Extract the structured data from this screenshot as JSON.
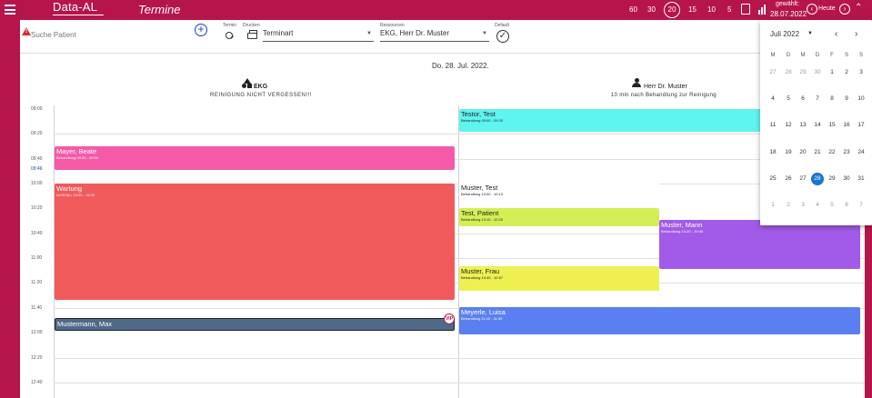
{
  "app": {
    "brand": "Data-AL",
    "title": "Termine",
    "zoom_levels": [
      "60",
      "30",
      "20",
      "15",
      "10",
      "5"
    ],
    "zoom_selected": "20",
    "selected_label": "gewählt:",
    "selected_date": "28.07.2022",
    "today_label": "Heute",
    "colors": {
      "primary": "#b5154b",
      "accent": "#1a3fb8"
    }
  },
  "toolbar": {
    "search_placeholder": "Suche Patient",
    "termin_label": "Termin",
    "drucken_label": "Drucken",
    "terminart_label": "Terminart",
    "ressourcen_label": "Ressourcen",
    "ressourcen_value": "EKG, Herr Dr. Muster",
    "default_label": "Default"
  },
  "calendar": {
    "date_heading": "Do. 28. Jul. 2022.",
    "resources": [
      {
        "name": "EKG",
        "note": "REINIGUNG NICHT VERGESSEN!!!"
      },
      {
        "name": "Herr Dr. Muster",
        "note": "10 min nach Behandlung zur Reinigung"
      }
    ],
    "time_labels": [
      "09:00",
      "09:20",
      "09:40",
      "09:46",
      "10:00",
      "10:20",
      "10:40",
      "11:00",
      "11:20",
      "11:40",
      "12:00",
      "12:20",
      "12:40"
    ],
    "appointments": [
      {
        "title": "Testor, Test",
        "sub": "Behandlung 09:00 - 09:20",
        "color": "#5ef4f0"
      },
      {
        "title": "Mayer, Beate",
        "sub": "Behandlung 09:30 - 09:50",
        "color": "#f45aa8"
      },
      {
        "title": "Wartung",
        "sub": "AUSFALL 10:00 - 11:00",
        "color": "#f05a5a"
      },
      {
        "title": "Muster, Test",
        "sub": "Behandlung 10:00 - 10:10",
        "color": "#ffffff"
      },
      {
        "title": "Test, Patient",
        "sub": "Behandlung 10:10 - 10:20",
        "color": "#d4ef55"
      },
      {
        "title": "Muster, Mann",
        "sub": "Behandlung 10:20 - 10:45",
        "color": "#a25ae8"
      },
      {
        "title": "Muster, Frau",
        "sub": "Behandlung 10:45 - 10:57",
        "color": "#eef052"
      },
      {
        "title": "Mustermann, Max",
        "sub": "",
        "color": "#4e6a8a",
        "badge": "VIP"
      },
      {
        "title": "Meyerle, Luisa",
        "sub": "Behandlung 11:10 - 11:30",
        "color": "#5a7ff0"
      }
    ]
  },
  "datepicker": {
    "month_label": "Juli 2022",
    "weekdays": [
      "M",
      "D",
      "M",
      "D",
      "F",
      "S",
      "S"
    ],
    "weeks": [
      [
        "27",
        "28",
        "29",
        "30",
        "1",
        "2",
        "3"
      ],
      [
        "4",
        "5",
        "6",
        "7",
        "8",
        "9",
        "10"
      ],
      [
        "11",
        "12",
        "13",
        "14",
        "15",
        "16",
        "17"
      ],
      [
        "18",
        "19",
        "20",
        "21",
        "22",
        "23",
        "24"
      ],
      [
        "25",
        "26",
        "27",
        "28",
        "29",
        "30",
        "31"
      ],
      [
        "1",
        "2",
        "3",
        "4",
        "5",
        "6",
        "7"
      ]
    ],
    "selected_day": "28"
  }
}
